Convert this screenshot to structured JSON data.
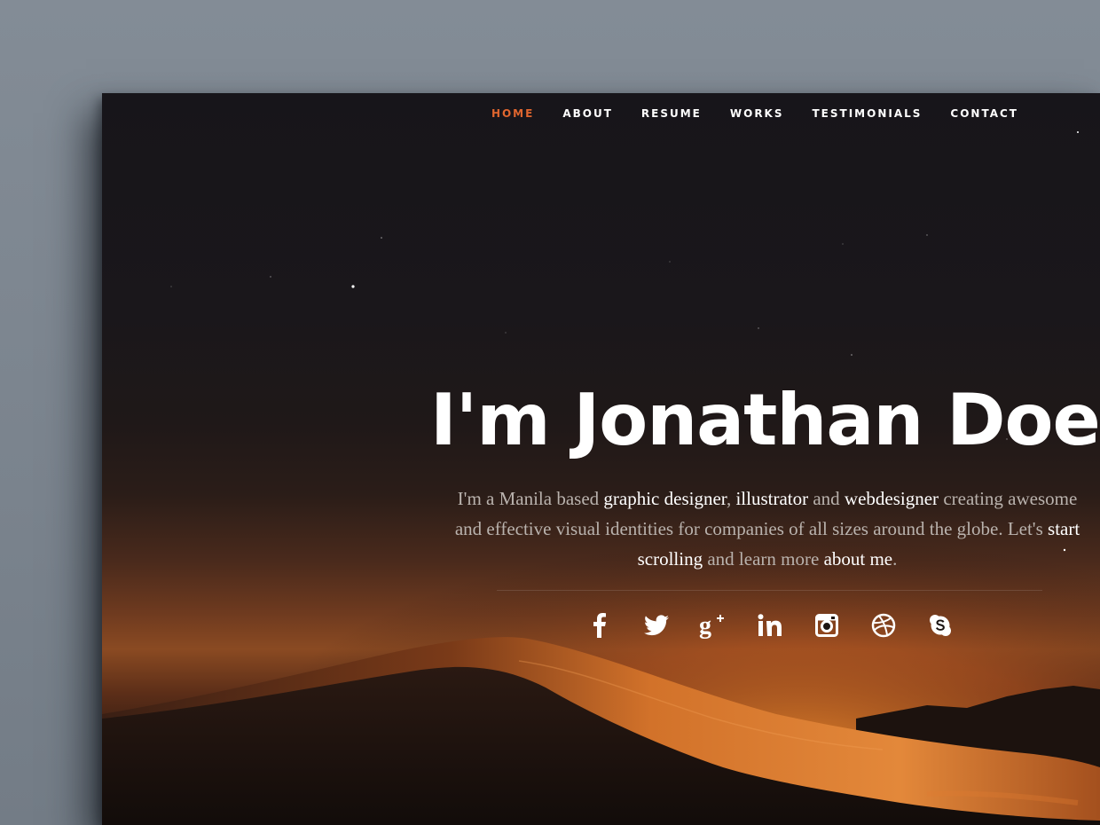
{
  "nav": {
    "items": [
      {
        "label": "HOME",
        "active": true
      },
      {
        "label": "ABOUT",
        "active": false
      },
      {
        "label": "RESUME",
        "active": false
      },
      {
        "label": "WORKS",
        "active": false
      },
      {
        "label": "TESTIMONIALS",
        "active": false
      },
      {
        "label": "CONTACT",
        "active": false
      }
    ]
  },
  "hero": {
    "title": "I'm Jonathan Doe.",
    "desc": {
      "t1": "I'm a Manila based ",
      "b1": "graphic designer",
      "t2": ", ",
      "b2": "illustrator",
      "t3": " and ",
      "b3": "webdesigner",
      "t4": " creating awesome and effective visual identities for companies of all sizes around the globe. Let's ",
      "b4": "start scrolling",
      "t5": " and learn more ",
      "b5": "about me",
      "t6": "."
    }
  },
  "social": {
    "icons": [
      "facebook-icon",
      "twitter-icon",
      "google-plus-icon",
      "linkedin-icon",
      "instagram-icon",
      "dribbble-icon",
      "skype-icon"
    ]
  },
  "colors": {
    "accent": "#e0662f",
    "text": "#ffffff",
    "muted_text": "#b9b2ad",
    "backdrop": "#7d8690"
  }
}
